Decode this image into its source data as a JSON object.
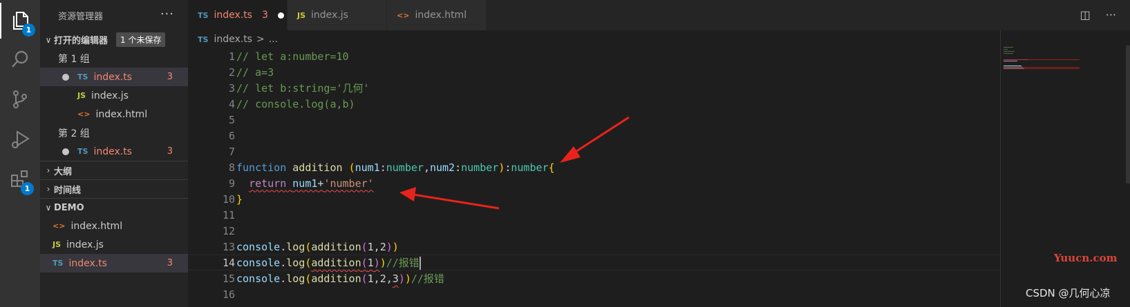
{
  "activity_bar": {
    "explorer_badge": "1",
    "extensions_badge": "1",
    "icons": [
      "files-icon",
      "search-icon",
      "source-control-icon",
      "run-debug-icon",
      "extensions-icon"
    ]
  },
  "sidebar": {
    "title": "资源管理器",
    "more": "···",
    "open_editors": {
      "label": "打开的编辑器",
      "unsaved_badge": "1 个未保存",
      "group1_label": "第 1 组",
      "group2_label": "第 2 组",
      "group1_items": [
        {
          "type": "TS",
          "name": "index.ts",
          "problems": "3"
        },
        {
          "type": "JS",
          "name": "index.js"
        },
        {
          "type": "<>",
          "name": "index.html"
        }
      ],
      "group2_items": [
        {
          "type": "TS",
          "name": "index.ts",
          "problems": "3"
        }
      ]
    },
    "outline_label": "大纲",
    "timeline_label": "时间线",
    "folder": {
      "label": "DEMO",
      "items": [
        {
          "type": "<>",
          "name": "index.html"
        },
        {
          "type": "JS",
          "name": "index.js"
        },
        {
          "type": "TS",
          "name": "index.ts",
          "problems": "3"
        }
      ]
    }
  },
  "tabs": [
    {
      "type": "TS",
      "name": "index.ts",
      "problems": "3"
    },
    {
      "type": "JS",
      "name": "index.js"
    },
    {
      "type": "<>",
      "name": "index.html"
    }
  ],
  "breadcrumb": {
    "type": "TS",
    "file": "index.ts",
    "sep": ">",
    "more": "..."
  },
  "line_numbers": [
    "1",
    "2",
    "3",
    "4",
    "5",
    "6",
    "7",
    "8",
    "9",
    "10",
    "11",
    "12",
    "13",
    "14",
    "15",
    "16"
  ],
  "code": {
    "l1": "// let a:number=10",
    "l2": "// a=3",
    "l3": "// let b:string='几何'",
    "l4": "// console.log(a,b)",
    "l8": {
      "kw": "function",
      "name": "addition",
      "sp": " ",
      "open": "(",
      "p1": "num1",
      "colon": ":",
      "t1": "number",
      "comma": ",",
      "p2": "num2",
      "t2": "number",
      "close": ")",
      "ret_colon": ":",
      "ret": "number",
      "brace": "{"
    },
    "l9": {
      "indent": "  ",
      "kw": "return",
      "var": "num1",
      "plus": "+",
      "str": "'number'"
    },
    "l10": "}",
    "l13": {
      "obj": "console",
      "dot": ".",
      "fn": "log",
      "o1": "(",
      "call": "addition",
      "o2": "(",
      "args": "1,2",
      "c2": ")",
      "c1": ")"
    },
    "l14": {
      "obj": "console",
      "dot": ".",
      "fn": "log",
      "o1": "(",
      "call": "addition",
      "o2": "(",
      "args": "1",
      "c2": ")",
      "c1": ")",
      "comment": "//报错"
    },
    "l15": {
      "obj": "console",
      "dot": ".",
      "fn": "log",
      "o1": "(",
      "call": "addition",
      "o2": "(",
      "args_ok": "1,2,",
      "args_err": "3",
      "c2": ")",
      "c1": ")",
      "comment": "//报错"
    }
  },
  "watermarks": {
    "site": "Yuucn.com",
    "author": "CSDN @几何心凉"
  },
  "colors": {
    "error": "#f48771",
    "accent": "#007acc",
    "arrow": "#e8231c"
  }
}
